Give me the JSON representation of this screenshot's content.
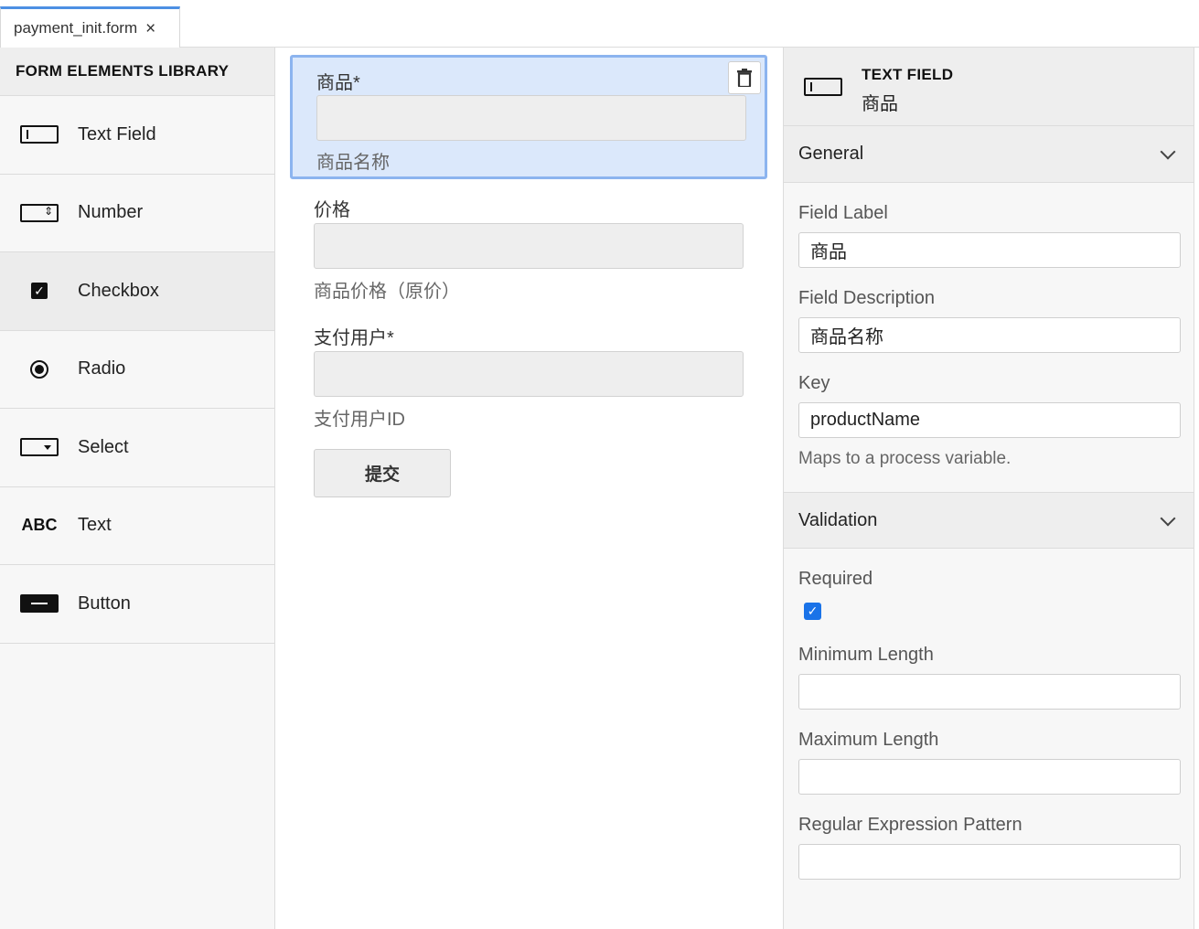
{
  "tab": {
    "title": "payment_init.form",
    "close": "×"
  },
  "library": {
    "header": "FORM ELEMENTS LIBRARY",
    "items": [
      {
        "label": "Text Field",
        "icon": "text-field-icon"
      },
      {
        "label": "Number",
        "icon": "number-icon"
      },
      {
        "label": "Checkbox",
        "icon": "checkbox-icon"
      },
      {
        "label": "Radio",
        "icon": "radio-icon"
      },
      {
        "label": "Select",
        "icon": "select-icon"
      },
      {
        "label": "Text",
        "icon": "text-icon",
        "glyph": "ABC"
      },
      {
        "label": "Button",
        "icon": "button-icon"
      }
    ]
  },
  "canvas": {
    "fields": [
      {
        "label": "商品*",
        "description": "商品名称"
      },
      {
        "label": "价格",
        "description": "商品价格（原价）"
      },
      {
        "label": "支付用户*",
        "description": "支付用户ID"
      }
    ],
    "submit_label": "提交"
  },
  "properties": {
    "type": "TEXT FIELD",
    "name": "商品",
    "general": {
      "title": "General",
      "field_label_title": "Field Label",
      "field_label_value": "商品",
      "field_description_title": "Field Description",
      "field_description_value": "商品名称",
      "key_title": "Key",
      "key_value": "productName",
      "key_hint": "Maps to a process variable."
    },
    "validation": {
      "title": "Validation",
      "required_title": "Required",
      "required_checked": true,
      "min_length_title": "Minimum Length",
      "min_length_value": "",
      "max_length_title": "Maximum Length",
      "max_length_value": "",
      "regex_title": "Regular Expression Pattern",
      "regex_value": ""
    }
  },
  "colors": {
    "accent": "#4d90e3",
    "selected_bg": "#dbe8fb",
    "checkbox": "#1a73e8"
  }
}
